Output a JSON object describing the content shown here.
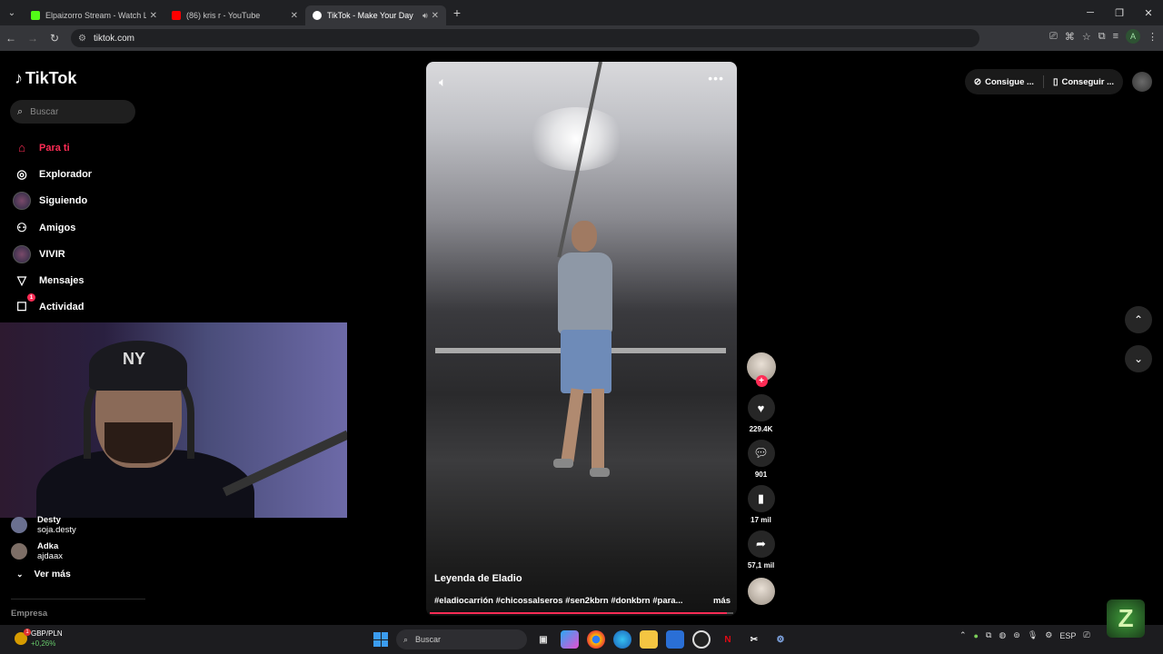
{
  "browser": {
    "tabs": [
      {
        "title": "Elpaizorro Stream - Watch Live",
        "favicon_color": "#53fc18",
        "active": false
      },
      {
        "title": "(86) kris r - YouTube",
        "favicon_color": "#ff0000",
        "active": false
      },
      {
        "title": "TikTok - Make Your Day",
        "favicon_color": "#ffffff",
        "active": true
      }
    ],
    "url": "tiktok.com",
    "profile_letter": "A"
  },
  "sidebar": {
    "logo": "TikTok",
    "search_placeholder": "Buscar",
    "nav": [
      {
        "label": "Para ti",
        "icon": "home-icon",
        "active": true
      },
      {
        "label": "Explorador",
        "icon": "compass-icon",
        "active": false
      },
      {
        "label": "Siguiendo",
        "icon": "avatar-icon",
        "active": false
      },
      {
        "label": "Amigos",
        "icon": "friends-icon",
        "active": false
      },
      {
        "label": "VIVIR",
        "icon": "live-avatar-icon",
        "active": false
      },
      {
        "label": "Mensajes",
        "icon": "send-icon",
        "active": false
      },
      {
        "label": "Actividad",
        "icon": "activity-icon",
        "active": false,
        "badge": "1"
      }
    ],
    "following": [
      {
        "name": "Desty",
        "handle": "soja.desty"
      },
      {
        "name": "Adka",
        "handle": "ajdaax"
      }
    ],
    "see_more": "Ver más",
    "footer": "Empresa"
  },
  "video": {
    "author": "Leyenda de Eladio",
    "caption": "#eladiocarrión #chicossalseros #sen2kbrn #donkbrn #para...",
    "more": "más",
    "progress": 0.98
  },
  "actions": {
    "likes": "229.4K",
    "comments": "901",
    "saves": "17 mil",
    "shares": "57,1 mil"
  },
  "topbar": {
    "get_app": "Consigue ...",
    "get_coins": "Conseguir ..."
  },
  "taskbar": {
    "stock_pair": "GBP/PLN",
    "stock_change": "+0,26%",
    "search_placeholder": "Buscar",
    "lang": "ESP"
  },
  "colors": {
    "accent": "#fe2c55",
    "background": "#000000"
  }
}
